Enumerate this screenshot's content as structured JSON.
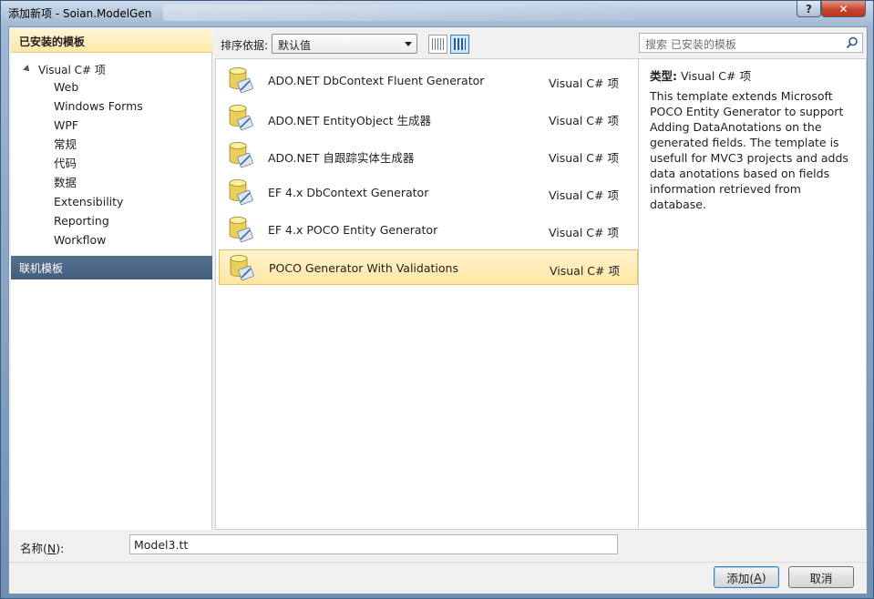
{
  "window": {
    "title": "添加新项 - Soian.ModelGen",
    "help_label": "?",
    "close_label": "✕"
  },
  "left": {
    "installed_header": "已安装的模板",
    "root_label": "Visual C# 项",
    "items": [
      "Web",
      "Windows Forms",
      "WPF",
      "常规",
      "代码",
      "数据",
      "Extensibility",
      "Reporting",
      "Workflow"
    ],
    "online_header": "联机模板"
  },
  "toolbar": {
    "sort_label": "排序依据:",
    "sort_value": "默认值"
  },
  "search": {
    "placeholder": "搜索 已安装的模板"
  },
  "templates": [
    {
      "name": "ADO.NET DbContext Fluent Generator",
      "lang": "Visual C# 项"
    },
    {
      "name": "ADO.NET EntityObject 生成器",
      "lang": "Visual C# 项"
    },
    {
      "name": "ADO.NET 自跟踪实体生成器",
      "lang": "Visual C# 项"
    },
    {
      "name": "EF 4.x DbContext Generator",
      "lang": "Visual C# 项"
    },
    {
      "name": "EF 4.x POCO Entity Generator",
      "lang": "Visual C# 项"
    },
    {
      "name": "POCO Generator With Validations",
      "lang": "Visual C# 项"
    }
  ],
  "selected_index": 5,
  "details": {
    "type_label": "类型:",
    "type_value": "Visual C# 项",
    "description": "This template extends Microsoft POCO Entity Generator to support Adding DataAnotations on the generated fields. The template is usefull for MVC3 projects  and adds data anotations based on fields information retrieved from database."
  },
  "name_field": {
    "label_prefix": "名称(",
    "label_key": "N",
    "label_suffix": "):",
    "value": "Model3.tt"
  },
  "buttons": {
    "add_prefix": "添加(",
    "add_key": "A",
    "add_suffix": ")",
    "cancel": "取消"
  }
}
